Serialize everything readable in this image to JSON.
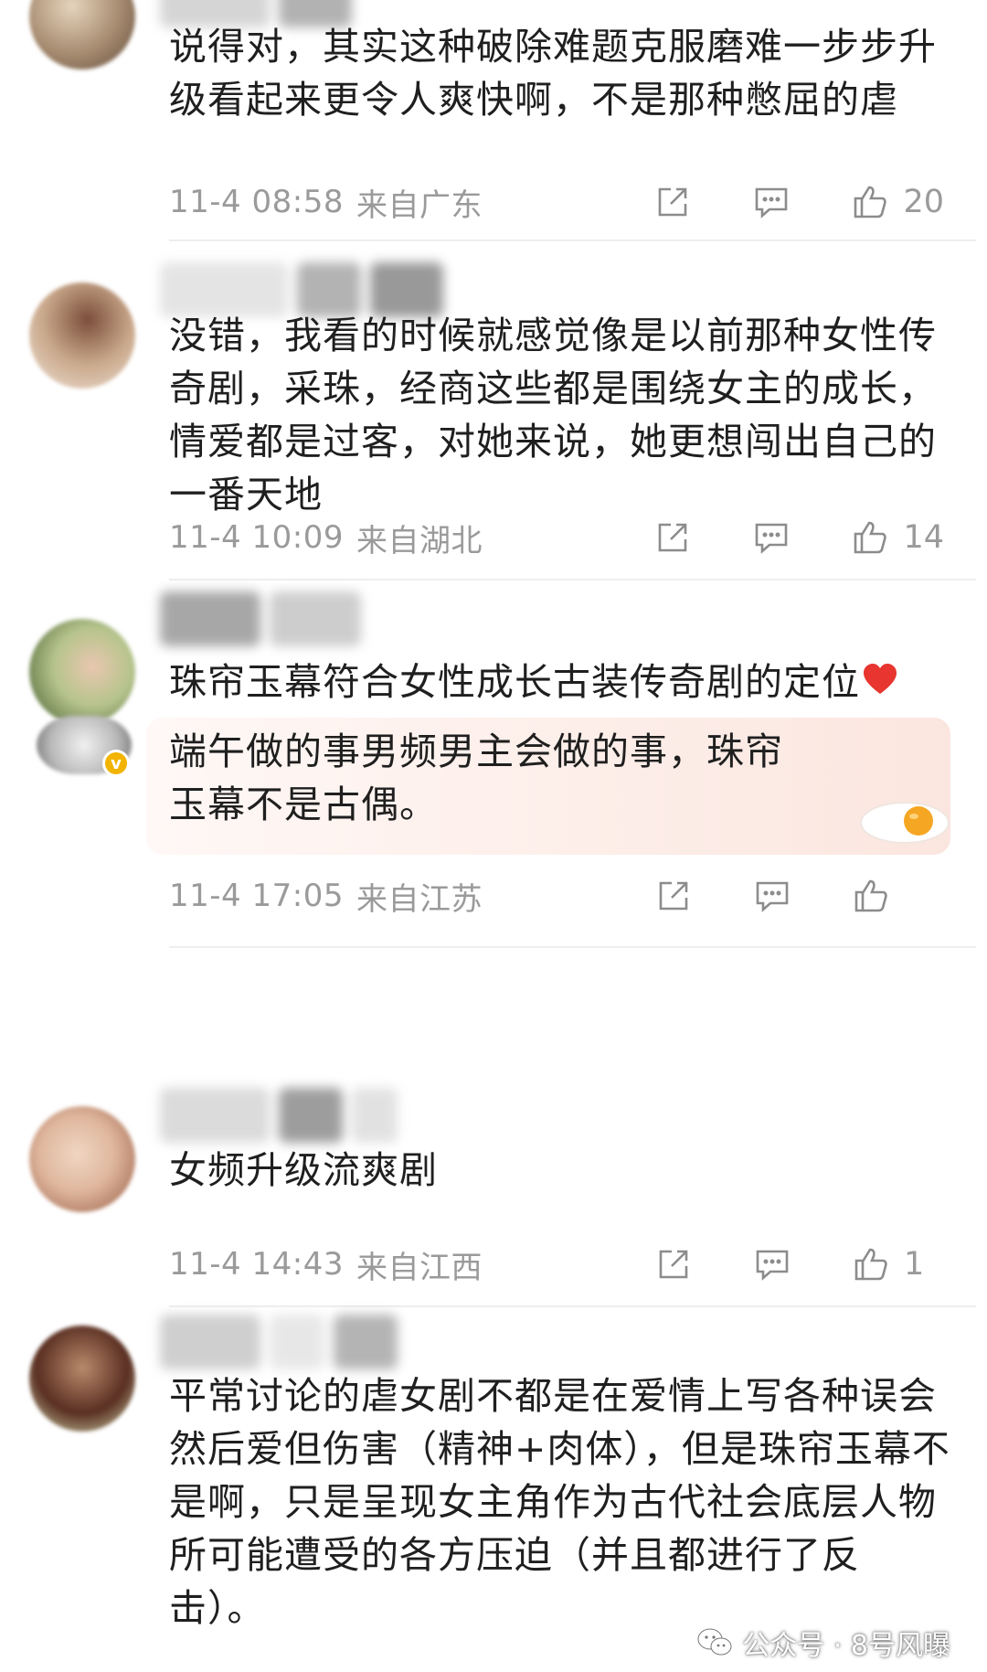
{
  "comments": [
    {
      "text": "说得对，其实这种破除难题克服磨难一步步升级看起来更令人爽快啊，不是那种憋屈的虐",
      "time": "11-4 08:58",
      "location": "来自广东",
      "likes": "20",
      "avatar_colors": [
        "#a58a6e",
        "#d9c2a5",
        "#5f4a3c"
      ]
    },
    {
      "text": "没错，我看的时候就感觉像是以前那种女性传奇剧，采珠，经商这些都是围绕女主的成长，情爱都是过客，对她来说，她更想闯出自己的一番天地",
      "time": "11-4 10:09",
      "location": "来自湖北",
      "likes": "14",
      "avatar_colors": [
        "#7b4e3a",
        "#caa98c",
        "#efe2d6"
      ]
    },
    {
      "text": "珠帘玉幕符合女性成长古装传奇剧的定位",
      "reply_text": "端午做的事男频男主会做的事，珠帘玉幕不是古偶。",
      "time": "11-4 17:05",
      "location": "来自江苏",
      "likes": "",
      "avatar_colors": [
        "#3f5a2c",
        "#e9c7b0",
        "#b6c48c"
      ]
    },
    {
      "text": "女频升级流爽剧",
      "time": "11-4 14:43",
      "location": "来自江西",
      "likes": "1",
      "avatar_colors": [
        "#b07a62",
        "#dfb79d",
        "#7a5a4a"
      ]
    },
    {
      "text": "平常讨论的虐女剧不都是在爱情上写各种误会然后爱但伤害（精神+肉体），但是珠帘玉幕不是啊，只是呈现女主角作为古代社会底层人物所可能遭受的各方压迫（并且都进行了反击）。",
      "avatar_colors": [
        "#5a2f22",
        "#b98a6b",
        "#d7dfb4"
      ]
    }
  ],
  "icons": {
    "share": "share-icon",
    "comment": "comment-icon",
    "like": "thumbs-up-icon",
    "heart": "heart-icon",
    "verified": "verified-badge-icon",
    "wechat": "wechat-icon"
  },
  "watermark": {
    "label": "公众号 · 8号风曝"
  },
  "colors": {
    "meta_gray": "#9a9a9a",
    "heart_red": "#e8352f",
    "verified_gold": "#f2b400",
    "divider": "#eeeeee"
  }
}
